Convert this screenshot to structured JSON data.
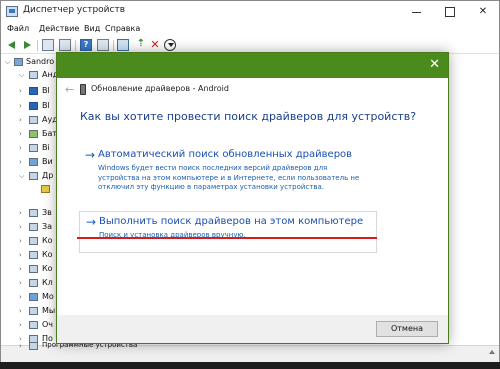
{
  "window": {
    "title": "Диспетчер устройств",
    "controls": {
      "minimize": "",
      "maximize": "",
      "close": "✕"
    }
  },
  "menu": [
    "Файл",
    "Действие",
    "Вид",
    "Справка"
  ],
  "tree": {
    "root": "Sandro",
    "items": [
      "Андро",
      "Bl",
      "Bl",
      "Ауд",
      "Бат",
      "Bi",
      "Ви",
      "Др",
      "",
      "Зв",
      "За",
      "Ко",
      "Ко",
      "Ко",
      "Кл",
      "Мо",
      "Мы",
      "Оч",
      "По",
      "По",
      "Пр"
    ],
    "bottom_item": "Программные устройства"
  },
  "dialog": {
    "header_title": "Обновление драйверов - Android",
    "question": "Как вы хотите провести поиск драйверов для устройств?",
    "options": [
      {
        "arrow": "→",
        "title": "Автоматический поиск обновленных драйверов",
        "description": "Windows будет вести поиск последних версий драйверов для устройства на этом компьютере и в Интернете, если пользователь не отключил эту функцию в параметрах установки устройства."
      },
      {
        "arrow": "→",
        "title": "Выполнить поиск драйверов на этом компьютере",
        "description": "Поиск и установка драйверов вручную."
      }
    ],
    "cancel_label": "Отмена",
    "close_glyph": "✕",
    "back_glyph": "←"
  },
  "colors": {
    "dialog_titlebar": "#4b8b1d",
    "link_blue": "#1a4fb0",
    "highlight_red": "#d81b1b"
  }
}
